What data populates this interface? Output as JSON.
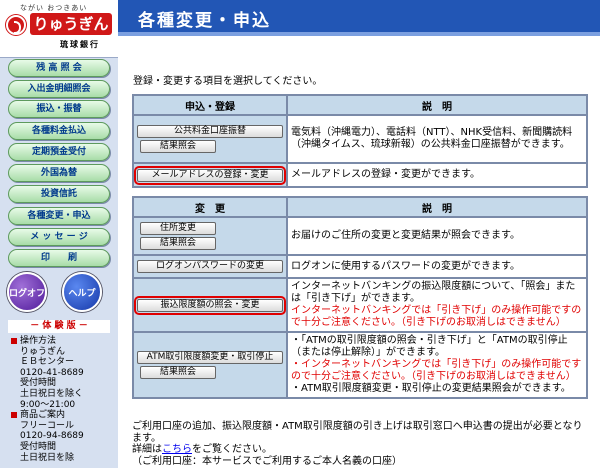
{
  "logo": {
    "tagline": "ながい おつきあい",
    "name": "りゅうぎん",
    "sub": "琉球銀行"
  },
  "sidebar": {
    "items": [
      {
        "label": "残 高 照 会"
      },
      {
        "label": "入出金明細照会"
      },
      {
        "label": "振込・振替"
      },
      {
        "label": "各種料金払込"
      },
      {
        "label": "定期預金受付"
      },
      {
        "label": "外国為替"
      },
      {
        "label": "投資信託"
      },
      {
        "label": "各種変更・申込"
      },
      {
        "label": "メ ッ セ ー ジ"
      },
      {
        "label": "印　　刷"
      }
    ],
    "logoff": "ログオフ",
    "help": "ヘルプ",
    "demo_heading": "－ 体 験 版 －",
    "info": {
      "ops_heading": "操作方法",
      "ops_lines": [
        "りゅうぎん",
        "ＥＢセンター",
        "0120-41-8689",
        "受付時間",
        "土日祝日を除く",
        "9:00～21:00"
      ],
      "product_heading": "商品ご案内",
      "product_lines": [
        "フリーコール",
        "0120-94-8689",
        "受付時間",
        "土日祝日を除"
      ]
    }
  },
  "header": {
    "title": "各種変更・申込"
  },
  "intro": "登録・変更する項目を選択してください。",
  "table1": {
    "col1": "申込・登録",
    "col2": "説　明",
    "rows": [
      {
        "buttons": [
          "公共料金口座振替",
          "結果照会"
        ],
        "desc": "電気料（沖縄電力）、電話料（NTT）、NHK受信料、新聞購読料（沖縄タイムス、琉球新報）の公共料金口座振替ができます。"
      },
      {
        "buttons": [
          "メールアドレスの登録・変更"
        ],
        "desc": "メールアドレスの登録・変更ができます。"
      }
    ]
  },
  "table2": {
    "col1": "変　更",
    "col2": "説　明",
    "rows": [
      {
        "buttons": [
          "住所変更",
          "結果照会"
        ],
        "desc": "お届けのご住所の変更と変更結果が照会できます。"
      },
      {
        "buttons": [
          "ログオンパスワードの変更"
        ],
        "desc": "ログオンに使用するパスワードの変更ができます。"
      },
      {
        "buttons": [
          "振込限度額の照会・変更"
        ],
        "desc": "インターネットバンキングの振込限度額について、「照会」または「引き下げ」ができます。",
        "warn": "インターネットバンキングでは「引き下げ」のみ操作可能ですので十分ご注意ください。（引き下げのお取消しはできません）"
      },
      {
        "buttons": [
          "ATM取引限度額変更・取引停止",
          "結果照会"
        ],
        "desc1": "・「ATMの取引限度額の照会・引き下げ」と「ATMの取引停止（または停止解除）」ができます。",
        "warn": "・インターネットバンキングでは「引き下げ」のみ操作可能ですので十分ご注意ください。（引き下げのお取消しはできません）",
        "desc2": "・ATM取引限度額変更・取引停止の変更結果照会ができます。"
      }
    ]
  },
  "footer": {
    "line1": "ご利用口座の追加、振込限度額・ATM取引限度額の引き上げは取引窓口へ申込書の提出が必要となります。",
    "line2_pre": "詳細は",
    "line2_link": "こちら",
    "line2_post": "をご覧ください。",
    "line3": "（ご利用口座：本サービスでご利用するご本人名義の口座）"
  }
}
